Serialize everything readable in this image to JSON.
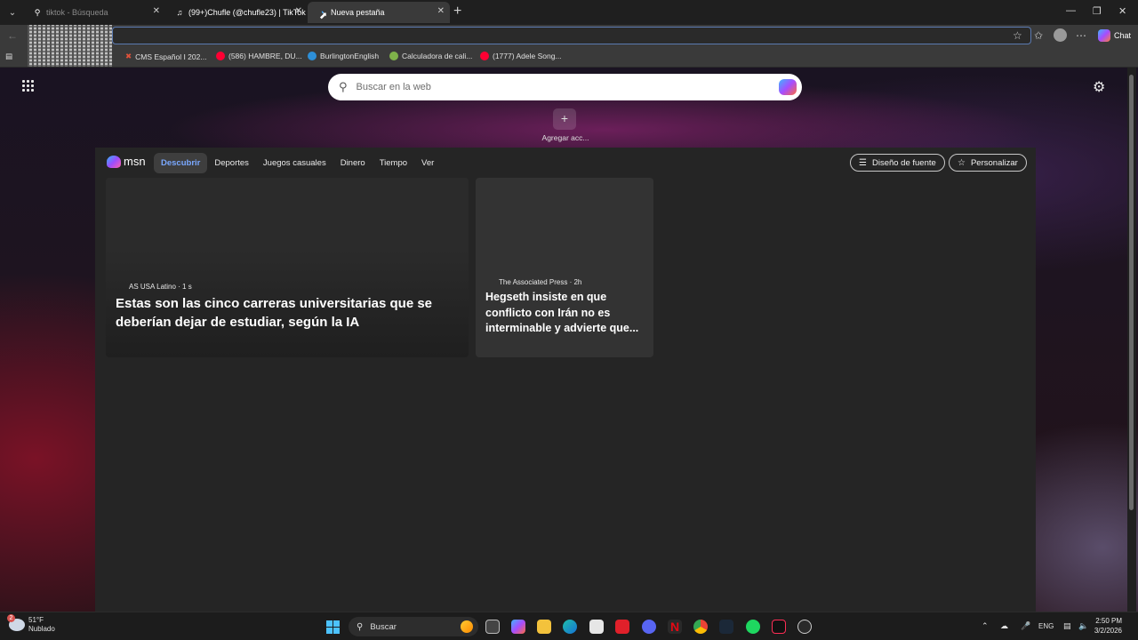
{
  "tabs": [
    {
      "label": "tiktok - Búsqueda",
      "favicon": "search-icon"
    },
    {
      "label": "(99+)Chufle (@chufle23) | TikTok",
      "favicon": "tiktok-icon"
    },
    {
      "label": "Nueva pestaña",
      "favicon": "edge-icon",
      "active": true
    }
  ],
  "toolbar": {
    "chat_label": "Chat"
  },
  "bookmarks": [
    {
      "label": "CMS Español I 202...",
      "icon": "cms-icon",
      "color": "#e0523a"
    },
    {
      "label": "(586) HAMBRE, DU...",
      "icon": "youtube-icon",
      "color": "#ff0033"
    },
    {
      "label": "BurlingtonEnglish",
      "icon": "burlington-icon",
      "color": "#2d8fd8"
    },
    {
      "label": "Calculadora de cali...",
      "icon": "calculator-icon",
      "color": "#7fb24a"
    },
    {
      "label": "(1777) Adele Song...",
      "icon": "youtube-icon",
      "color": "#ff0033"
    }
  ],
  "newtab": {
    "search_placeholder": "Buscar en la web",
    "add_shortcut_label": "Agregar acc..."
  },
  "feed": {
    "nav": [
      "Descubrir",
      "Deportes",
      "Juegos casuales",
      "Dinero",
      "Tiempo",
      "Ver"
    ],
    "font_design_label": "Diseño de fuente",
    "personalize_label": "Personalizar",
    "cards": [
      {
        "source": "AS USA Latino · 1 s",
        "headline": "Estas son las cinco carreras universitarias que se deberían dejar de estudiar, según la IA"
      },
      {
        "source": "The Associated Press · 2h",
        "headline": "Hegseth insiste en que conflicto con Irán no es interminable y advierte que..."
      }
    ],
    "logo_text": "msn"
  },
  "taskbar": {
    "weather_temp": "51°F",
    "weather_desc": "Nublado",
    "weather_badge": "2",
    "search_label": "Buscar",
    "lang": "ENG",
    "time": "2:50 PM",
    "date": "3/2/2026"
  }
}
